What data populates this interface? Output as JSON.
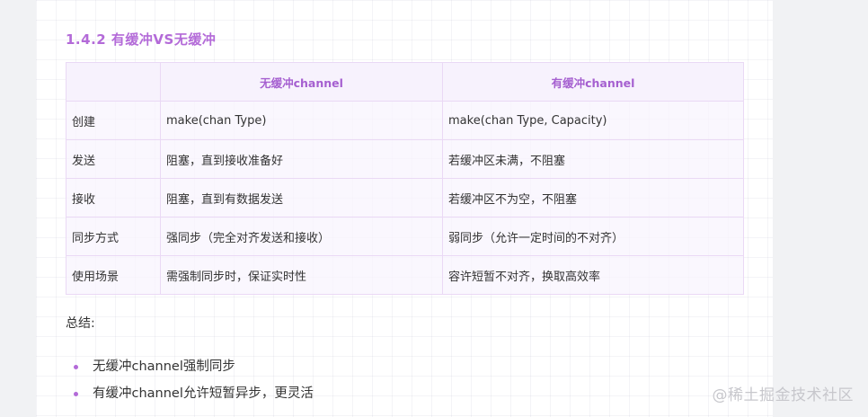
{
  "section": {
    "title": "1.4.2 有缓冲VS无缓冲"
  },
  "table": {
    "headers": [
      "",
      "无缓冲channel",
      "有缓冲channel"
    ],
    "rows": [
      {
        "label": "创建",
        "unbuffered": "make(chan Type)",
        "buffered": "make(chan Type, Capacity)"
      },
      {
        "label": "发送",
        "unbuffered": "阻塞，直到接收准备好",
        "buffered": "若缓冲区未满，不阻塞"
      },
      {
        "label": "接收",
        "unbuffered": "阻塞，直到有数据发送",
        "buffered": "若缓冲区不为空，不阻塞"
      },
      {
        "label": "同步方式",
        "unbuffered": "强同步（完全对齐发送和接收）",
        "buffered": "弱同步（允许一定时间的不对齐）"
      },
      {
        "label": "使用场景",
        "unbuffered": "需强制同步时，保证实时性",
        "buffered": "容许短暂不对齐，换取高效率"
      }
    ]
  },
  "summary": {
    "label": "总结:",
    "points": [
      "无缓冲channel强制同步",
      "有缓冲channel允许短暂异步，更灵活"
    ]
  },
  "watermark": "@稀土掘金技术社区",
  "colors": {
    "accent": "#b36ad8",
    "table_border": "#ead9f5",
    "header_bg": "#f7f2fd"
  }
}
